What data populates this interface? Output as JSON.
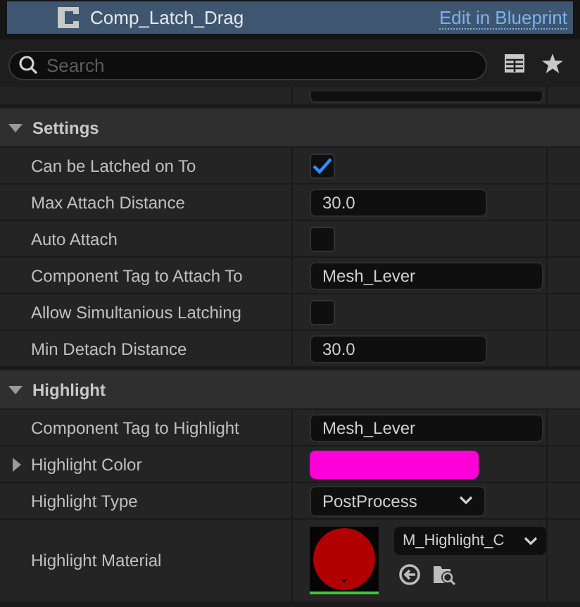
{
  "header": {
    "title": "Comp_Latch_Drag",
    "link": "Edit in Blueprint"
  },
  "search": {
    "placeholder": "Search"
  },
  "sections": [
    {
      "title": "Settings",
      "expanded": true,
      "rows": [
        {
          "kind": "checkbox",
          "label": "Can be Latched on To",
          "checked": true
        },
        {
          "kind": "text",
          "label": "Max Attach Distance",
          "value": "30.0"
        },
        {
          "kind": "checkbox",
          "label": "Auto Attach",
          "checked": false
        },
        {
          "kind": "text",
          "label": "Component Tag to Attach To",
          "value": "Mesh_Lever"
        },
        {
          "kind": "checkbox",
          "label": "Allow Simultanious Latching",
          "checked": false
        },
        {
          "kind": "text",
          "label": "Min Detach Distance",
          "value": "30.0"
        }
      ]
    },
    {
      "title": "Highlight",
      "expanded": true,
      "rows": [
        {
          "kind": "text",
          "label": "Component Tag to Highlight",
          "value": "Mesh_Lever"
        },
        {
          "kind": "color",
          "label": "Highlight Color",
          "color": "#ff00d8",
          "expanded": false
        },
        {
          "kind": "dropdown",
          "label": "Highlight Type",
          "value": "PostProcess"
        },
        {
          "kind": "asset",
          "label": "Highlight Material",
          "value": "M_Highlight_C"
        }
      ]
    }
  ]
}
